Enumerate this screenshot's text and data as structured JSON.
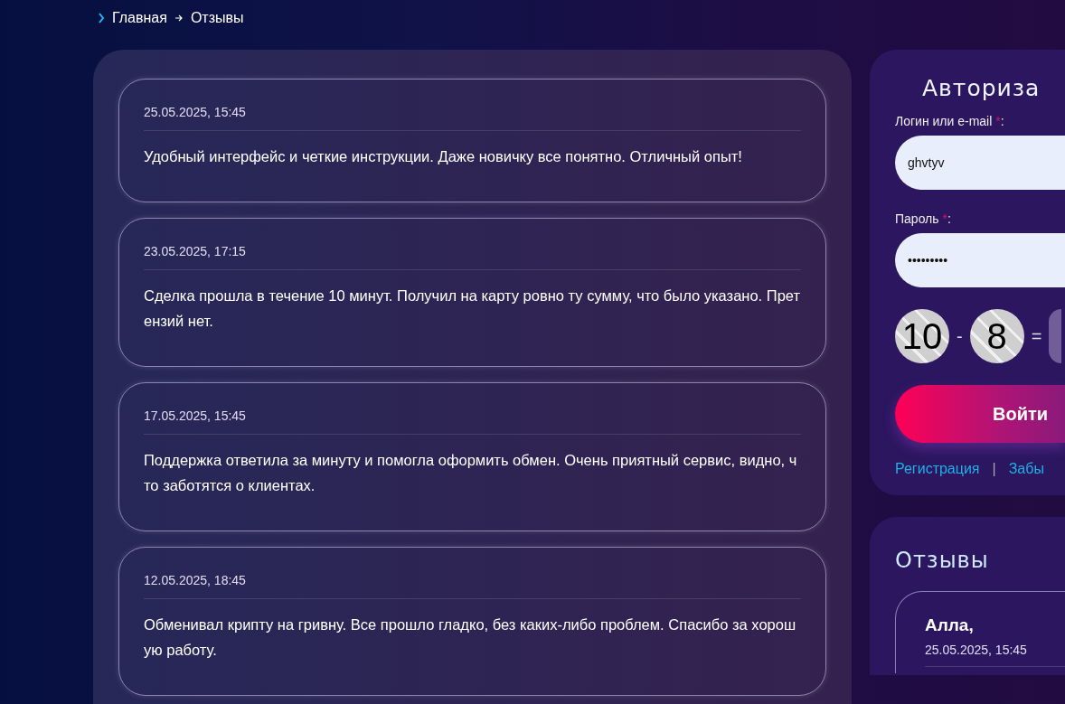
{
  "breadcrumb": [
    {
      "label": "Главная"
    },
    {
      "label": "Отзывы"
    }
  ],
  "reviews": [
    {
      "date": "25.05.2025, 15:45",
      "text": "Удобный интерфейс и четкие инструкции. Даже новичку все понятно. Отличный опыт!"
    },
    {
      "date": "23.05.2025, 17:15",
      "text": "Сделка прошла в течение 10 минут. Получил на карту ровно ту сумму, что было указано. Претензий нет."
    },
    {
      "date": "17.05.2025, 15:45",
      "text": "Поддержка ответила за минуту и помогла оформить обмен. Очень приятный сервис, видно, что заботятся о клиентах."
    },
    {
      "date": "12.05.2025, 18:45",
      "text": "Обменивал крипту на гривну. Все прошло гладко, без каких-либо проблем. Спасибо за хорошую работу."
    }
  ],
  "login": {
    "title": "Авториза",
    "fields": [
      {
        "label": "Логин или e-mail",
        "required": "*",
        "suffix": ":",
        "value": "ghvtyv"
      },
      {
        "label": "Пароль",
        "required": "*",
        "suffix": ":",
        "value": "•••••••••"
      }
    ],
    "captcha": {
      "a": "10",
      "op": "-",
      "b": "8",
      "eq": "="
    },
    "submit": "Войти",
    "links": [
      {
        "label": "Регистрация"
      },
      {
        "label": "Забы"
      }
    ],
    "separator": "|"
  },
  "side_reviews": {
    "title": "Отзывы",
    "items": [
      {
        "author": "Алла,",
        "date": "25.05.2025, 15:45"
      }
    ]
  }
}
